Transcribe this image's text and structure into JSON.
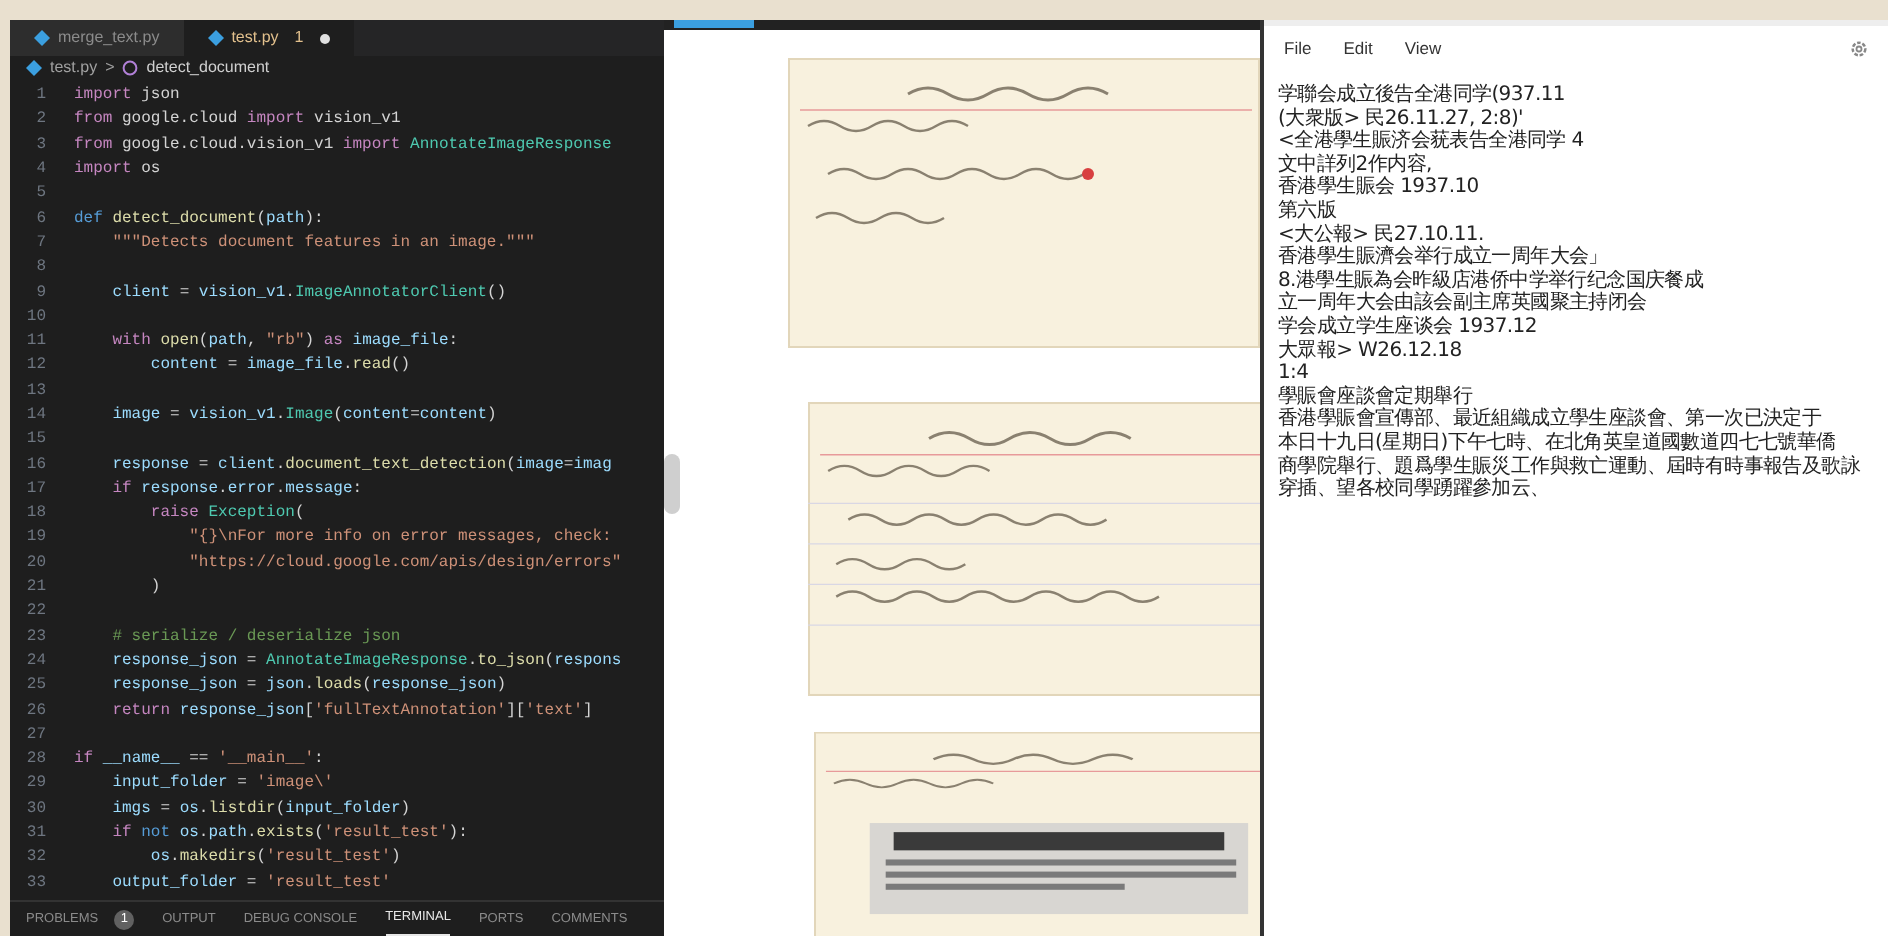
{
  "editor": {
    "tabs": [
      {
        "label": "merge_text.py",
        "selected": false,
        "modified": false
      },
      {
        "label": "test.py",
        "selected": true,
        "problems": "1",
        "modified": true
      }
    ],
    "breadcrumb": [
      "test.py",
      "detect_document"
    ],
    "breadcrumb_separator": ">",
    "lines": [
      {
        "number": "1",
        "tokens": [
          {
            "kind": "kw",
            "text": "import"
          },
          {
            "kind": "p",
            "text": " json"
          }
        ]
      },
      {
        "number": "2",
        "tokens": [
          {
            "kind": "kw",
            "text": "from"
          },
          {
            "kind": "p",
            "text": " google.cloud "
          },
          {
            "kind": "kw",
            "text": "import"
          },
          {
            "kind": "p",
            "text": " vision_v1"
          }
        ]
      },
      {
        "number": "3",
        "tokens": [
          {
            "kind": "kw",
            "text": "from"
          },
          {
            "kind": "p",
            "text": " google.cloud.vision_v1 "
          },
          {
            "kind": "kw",
            "text": "import"
          },
          {
            "kind": "cls",
            "text": " AnnotateImageResponse"
          }
        ]
      },
      {
        "number": "4",
        "tokens": [
          {
            "kind": "kw",
            "text": "import"
          },
          {
            "kind": "p",
            "text": " os"
          }
        ]
      },
      {
        "number": "5"
      },
      {
        "number": "6",
        "tokens": [
          {
            "kind": "kwb",
            "text": "def"
          },
          {
            "kind": "fn",
            "text": " detect_document"
          },
          {
            "kind": "p",
            "text": "("
          },
          {
            "kind": "var",
            "text": "path"
          },
          {
            "kind": "p",
            "text": "):"
          }
        ]
      },
      {
        "number": "7",
        "tokens": [
          {
            "kind": "str",
            "text": "    \"\"\"Detects document features in an image.\"\"\""
          }
        ]
      },
      {
        "number": "8"
      },
      {
        "number": "9",
        "tokens": [
          {
            "kind": "var",
            "text": "    client"
          },
          {
            "kind": "p",
            "text": " = "
          },
          {
            "kind": "var",
            "text": "vision_v1"
          },
          {
            "kind": "p",
            "text": "."
          },
          {
            "kind": "cls",
            "text": "ImageAnnotatorClient"
          },
          {
            "kind": "p",
            "text": "()"
          }
        ]
      },
      {
        "number": "10"
      },
      {
        "number": "11",
        "tokens": [
          {
            "kind": "kw",
            "text": "    with"
          },
          {
            "kind": "fn",
            "text": " open"
          },
          {
            "kind": "p",
            "text": "("
          },
          {
            "kind": "var",
            "text": "path"
          },
          {
            "kind": "p",
            "text": ", "
          },
          {
            "kind": "str",
            "text": "\"rb\""
          },
          {
            "kind": "p",
            "text": ") "
          },
          {
            "kind": "kw",
            "text": "as"
          },
          {
            "kind": "var",
            "text": " image_file"
          },
          {
            "kind": "p",
            "text": ":"
          }
        ]
      },
      {
        "number": "12",
        "tokens": [
          {
            "kind": "var",
            "text": "        content"
          },
          {
            "kind": "p",
            "text": " = "
          },
          {
            "kind": "var",
            "text": "image_file"
          },
          {
            "kind": "p",
            "text": "."
          },
          {
            "kind": "fn",
            "text": "read"
          },
          {
            "kind": "p",
            "text": "()"
          }
        ]
      },
      {
        "number": "13"
      },
      {
        "number": "14",
        "tokens": [
          {
            "kind": "var",
            "text": "    image"
          },
          {
            "kind": "p",
            "text": " = "
          },
          {
            "kind": "var",
            "text": "vision_v1"
          },
          {
            "kind": "p",
            "text": "."
          },
          {
            "kind": "cls",
            "text": "Image"
          },
          {
            "kind": "p",
            "text": "("
          },
          {
            "kind": "var",
            "text": "content"
          },
          {
            "kind": "p",
            "text": "="
          },
          {
            "kind": "var",
            "text": "content"
          },
          {
            "kind": "p",
            "text": ")"
          }
        ]
      },
      {
        "number": "15"
      },
      {
        "number": "16",
        "tokens": [
          {
            "kind": "var",
            "text": "    response"
          },
          {
            "kind": "p",
            "text": " = "
          },
          {
            "kind": "var",
            "text": "client"
          },
          {
            "kind": "p",
            "text": "."
          },
          {
            "kind": "fn",
            "text": "document_text_detection"
          },
          {
            "kind": "p",
            "text": "("
          },
          {
            "kind": "var",
            "text": "image"
          },
          {
            "kind": "p",
            "text": "="
          },
          {
            "kind": "var",
            "text": "imag"
          }
        ]
      },
      {
        "number": "17",
        "tokens": [
          {
            "kind": "kw",
            "text": "    if"
          },
          {
            "kind": "var",
            "text": " response"
          },
          {
            "kind": "p",
            "text": "."
          },
          {
            "kind": "var",
            "text": "error"
          },
          {
            "kind": "p",
            "text": "."
          },
          {
            "kind": "var",
            "text": "message"
          },
          {
            "kind": "p",
            "text": ":"
          }
        ]
      },
      {
        "number": "18",
        "tokens": [
          {
            "kind": "kw",
            "text": "        raise"
          },
          {
            "kind": "cls",
            "text": " Exception"
          },
          {
            "kind": "p",
            "text": "("
          }
        ]
      },
      {
        "number": "19",
        "tokens": [
          {
            "kind": "str",
            "text": "            \"{}\\nFor more info on error messages, check:"
          }
        ]
      },
      {
        "number": "20",
        "tokens": [
          {
            "kind": "str",
            "text": "            \"https://cloud.google.com/apis/design/errors\""
          }
        ]
      },
      {
        "number": "21",
        "tokens": [
          {
            "kind": "p",
            "text": "        )"
          }
        ]
      },
      {
        "number": "22"
      },
      {
        "number": "23",
        "tokens": [
          {
            "kind": "cm",
            "text": "    # serialize / deserialize json"
          }
        ]
      },
      {
        "number": "24",
        "tokens": [
          {
            "kind": "var",
            "text": "    response_json"
          },
          {
            "kind": "p",
            "text": " = "
          },
          {
            "kind": "cls",
            "text": "AnnotateImageResponse"
          },
          {
            "kind": "p",
            "text": "."
          },
          {
            "kind": "fn",
            "text": "to_json"
          },
          {
            "kind": "p",
            "text": "("
          },
          {
            "kind": "var",
            "text": "respons"
          }
        ]
      },
      {
        "number": "25",
        "tokens": [
          {
            "kind": "var",
            "text": "    response_json"
          },
          {
            "kind": "p",
            "text": " = "
          },
          {
            "kind": "var",
            "text": "json"
          },
          {
            "kind": "p",
            "text": "."
          },
          {
            "kind": "fn",
            "text": "loads"
          },
          {
            "kind": "p",
            "text": "("
          },
          {
            "kind": "var",
            "text": "response_json"
          },
          {
            "kind": "p",
            "text": ")"
          }
        ]
      },
      {
        "number": "26",
        "tokens": [
          {
            "kind": "kw",
            "text": "    return"
          },
          {
            "kind": "var",
            "text": " response_json"
          },
          {
            "kind": "p",
            "text": "["
          },
          {
            "kind": "str",
            "text": "'fullTextAnnotation'"
          },
          {
            "kind": "p",
            "text": "]["
          },
          {
            "kind": "str",
            "text": "'text'"
          },
          {
            "kind": "p",
            "text": "]"
          }
        ]
      },
      {
        "number": "27"
      },
      {
        "number": "28",
        "tokens": [
          {
            "kind": "kw",
            "text": "if"
          },
          {
            "kind": "var",
            "text": " __name__"
          },
          {
            "kind": "p",
            "text": " == "
          },
          {
            "kind": "str",
            "text": "'__main__'"
          },
          {
            "kind": "p",
            "text": ":"
          }
        ]
      },
      {
        "number": "29",
        "tokens": [
          {
            "kind": "var",
            "text": "    input_folder"
          },
          {
            "kind": "p",
            "text": " = "
          },
          {
            "kind": "str",
            "text": "'image\\'"
          }
        ]
      },
      {
        "number": "30",
        "tokens": [
          {
            "kind": "var",
            "text": "    imgs"
          },
          {
            "kind": "p",
            "text": " = "
          },
          {
            "kind": "var",
            "text": "os"
          },
          {
            "kind": "p",
            "text": "."
          },
          {
            "kind": "fn",
            "text": "listdir"
          },
          {
            "kind": "p",
            "text": "("
          },
          {
            "kind": "var",
            "text": "input_folder"
          },
          {
            "kind": "p",
            "text": ")"
          }
        ]
      },
      {
        "number": "31",
        "tokens": [
          {
            "kind": "kw",
            "text": "    if"
          },
          {
            "kind": "kwb",
            "text": " not"
          },
          {
            "kind": "var",
            "text": " os"
          },
          {
            "kind": "p",
            "text": "."
          },
          {
            "kind": "var",
            "text": "path"
          },
          {
            "kind": "p",
            "text": "."
          },
          {
            "kind": "fn",
            "text": "exists"
          },
          {
            "kind": "p",
            "text": "("
          },
          {
            "kind": "str",
            "text": "'result_test'"
          },
          {
            "kind": "p",
            "text": "):"
          }
        ]
      },
      {
        "number": "32",
        "tokens": [
          {
            "kind": "var",
            "text": "        os"
          },
          {
            "kind": "p",
            "text": "."
          },
          {
            "kind": "fn",
            "text": "makedirs"
          },
          {
            "kind": "p",
            "text": "("
          },
          {
            "kind": "str",
            "text": "'result_test'"
          },
          {
            "kind": "p",
            "text": ")"
          }
        ]
      },
      {
        "number": "33",
        "tokens": [
          {
            "kind": "var",
            "text": "    output_folder"
          },
          {
            "kind": "p",
            "text": " = "
          },
          {
            "kind": "str",
            "text": "'result_test'"
          }
        ]
      }
    ],
    "panel_tabs": [
      {
        "label": "PROBLEMS",
        "badge": "1",
        "selected": false
      },
      {
        "label": "OUTPUT",
        "selected": false
      },
      {
        "label": "DEBUG CONSOLE",
        "selected": false
      },
      {
        "label": "TERMINAL",
        "selected": true
      },
      {
        "label": "PORTS",
        "selected": false
      },
      {
        "label": "COMMENTS",
        "selected": false
      }
    ]
  },
  "notepad": {
    "menu": [
      "File",
      "Edit",
      "View"
    ],
    "lines": [
      "学聯会成立後告全港同学(937.11",
      "(大衆版> 民26.11.27, 2:8)'",
      "<全港學生賑济会莸表告全港同学 4",
      "文中詳列2作内容,",
      "香港學生賑会 1937.10",
      "第六版",
      "<大公報> 民27.10.11.",
      "香港學生賑濟会举行成立一周年大会」",
      "8.港學生賑為会昨級店港侨中学举行纪念国庆餐成",
      "立一周年大会由該会副主席英國聚主持闭会",
      "学会成立学生座谈会 1937.12",
      "大眾報> W26.12.18",
      "1:4",
      "學賑會座談會定期舉行",
      "香港學賑會宣傳部、最近組織成立學生座談會、第一次已決定于",
      "本日十九日(星期日)下午七時、在北角英皇道國數道四七七號華僑",
      "商學院舉行、題爲學生賑災工作與救亡運動、屆時有時事報告及歌詠",
      "穿插、望各校同學踴躍參加云、"
    ]
  }
}
